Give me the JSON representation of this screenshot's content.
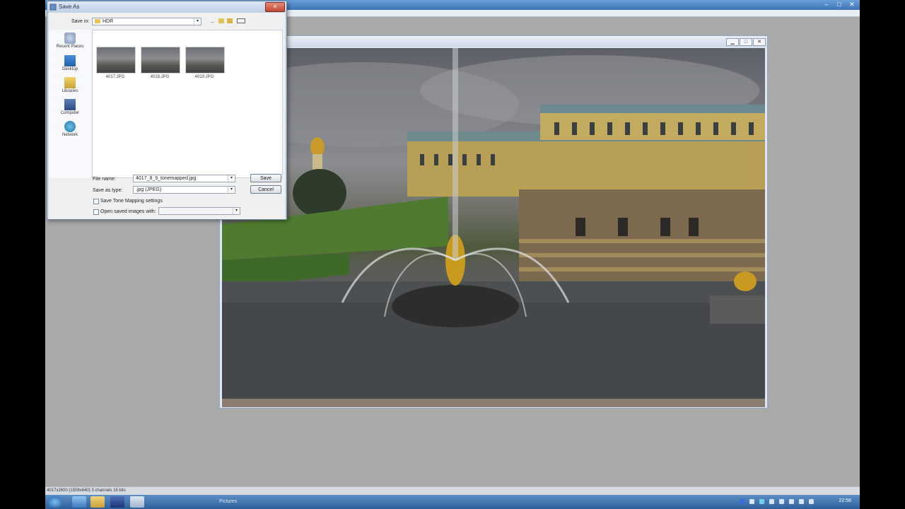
{
  "dialog": {
    "title": "Save As",
    "save_in_label": "Save in:",
    "save_in_value": "HDR",
    "places": [
      "Recent Places",
      "Desktop",
      "Libraries",
      "Computer",
      "Network"
    ],
    "files": [
      "4017.JPG",
      "4018.JPG",
      "4019.JPG"
    ],
    "file_name_label": "File name:",
    "file_name_value": "4017_8_9_tonemapped.jpg",
    "save_as_type_label": "Save as type:",
    "save_as_type_value": ".jpg (JPEG)",
    "save_button": "Save",
    "cancel_button": "Cancel",
    "save_tm_settings": "Save Tone Mapping settings",
    "open_saved_with": "Open saved images with:"
  },
  "image_window": {
    "title": "...)"
  },
  "status": {
    "text": "4017x2600 (1508x640) 3 channels 16 bits"
  },
  "taskbar": {
    "window_label": "Pictures",
    "clock": "22:56"
  },
  "colors": {
    "titlebar": "#3f74b6",
    "taskbar": "#2d5f9a",
    "dialog_frame": "#cfdcec",
    "close_button": "#c54632"
  }
}
